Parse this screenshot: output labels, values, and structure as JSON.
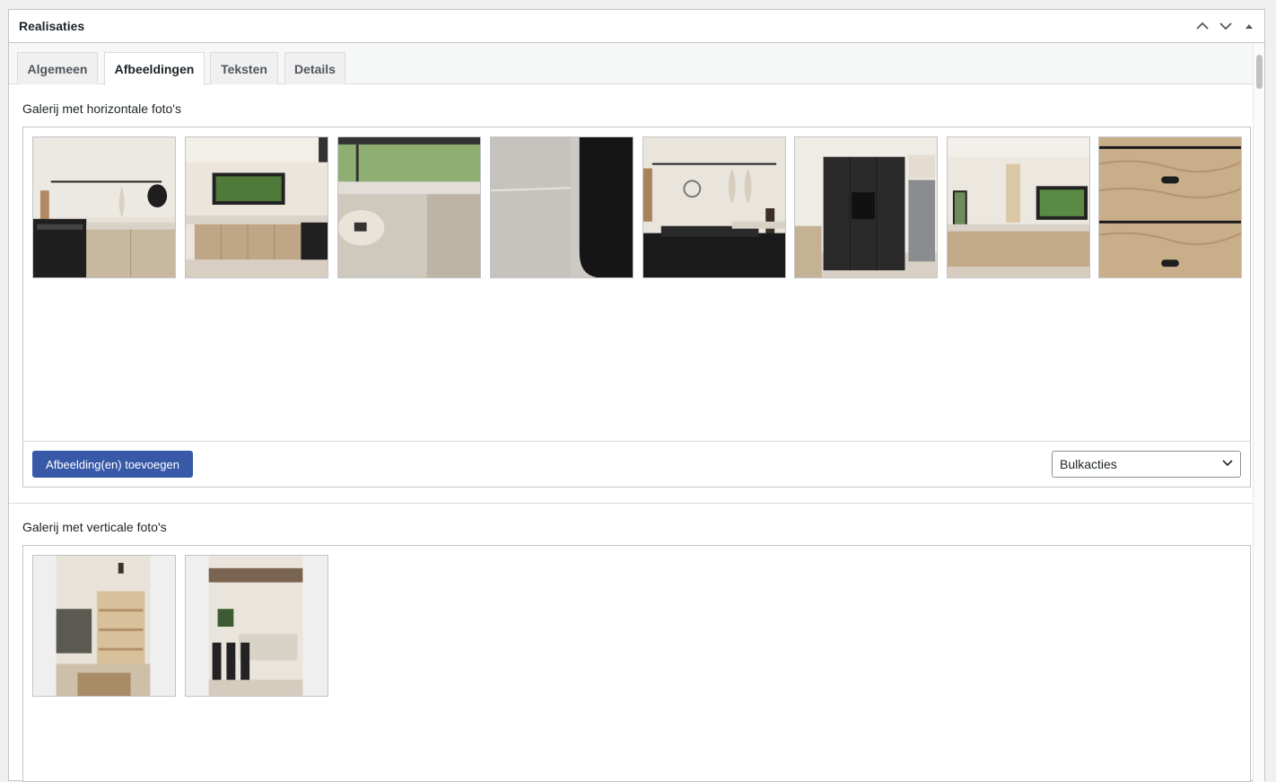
{
  "metabox": {
    "title": "Realisaties"
  },
  "header_icons": [
    "chevron-up-icon",
    "chevron-down-icon",
    "triangle-up-icon"
  ],
  "tabs": [
    {
      "label": "Algemeen",
      "active": false
    },
    {
      "label": "Afbeeldingen",
      "active": true
    },
    {
      "label": "Teksten",
      "active": false
    },
    {
      "label": "Details",
      "active": false
    }
  ],
  "horizontal_gallery": {
    "label": "Galerij met horizontale foto's",
    "images": [
      "kitchen-wall-rail-range",
      "kitchen-window-u-shape",
      "stone-countertop-closeup",
      "stone-black-panel-closeup",
      "kitchen-wall-rail-hob",
      "black-tall-cabinets",
      "kitchen-window-shelves",
      "oak-drawers-handles"
    ],
    "add_button_label": "Afbeelding(en) toevoegen",
    "bulk_actions": {
      "selected": "Bulkacties"
    }
  },
  "vertical_gallery": {
    "label": "Galerij met verticale foto's",
    "images": [
      "kitchen-lit-shelves-vertical",
      "kitchen-island-stools-vertical"
    ]
  },
  "colors": {
    "primary_button": "#3858a8",
    "border": "#c3c4c7",
    "background": "#f0f0f1"
  }
}
